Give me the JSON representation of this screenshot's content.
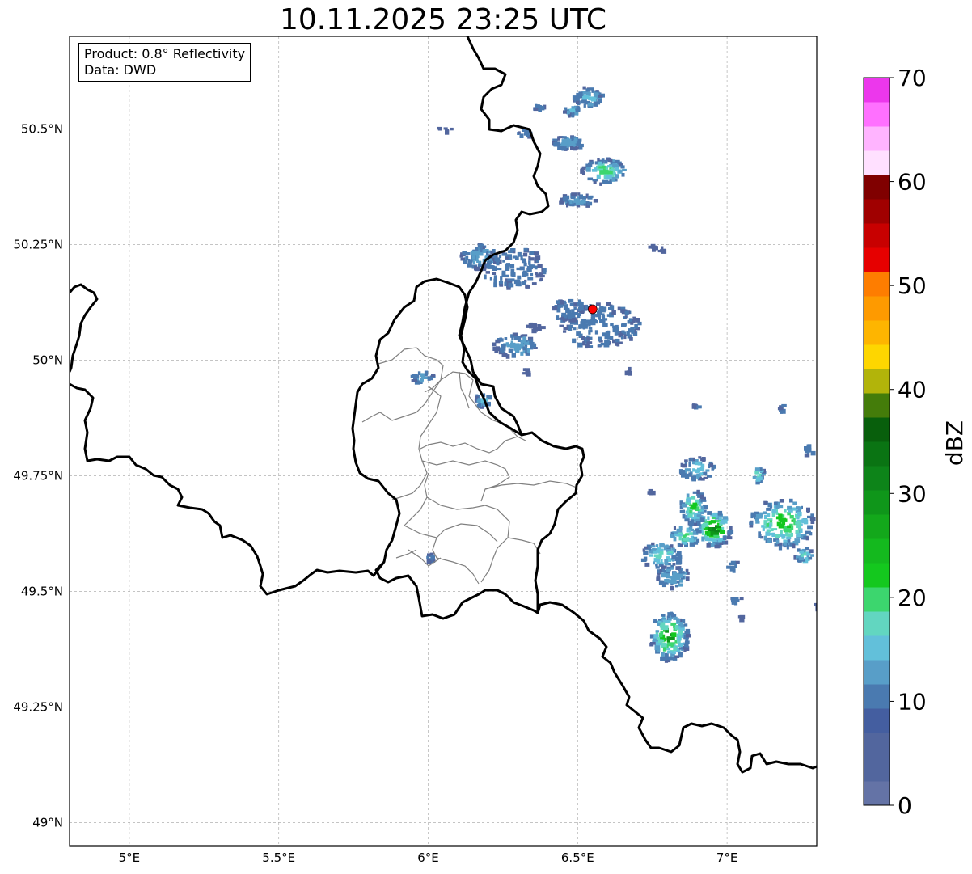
{
  "map": {
    "title": "10.11.2025 23:25 UTC",
    "info": {
      "product": "Product: 0.8° Reflectivity",
      "data": "Data: DWD"
    },
    "lon_ticks": [
      {
        "value": 5.0,
        "label": "5°E"
      },
      {
        "value": 5.5,
        "label": "5.5°E"
      },
      {
        "value": 6.0,
        "label": "6°E"
      },
      {
        "value": 6.5,
        "label": "6.5°E"
      },
      {
        "value": 7.0,
        "label": "7°E"
      }
    ],
    "lat_ticks": [
      {
        "value": 50.5,
        "label": "50.5°N"
      },
      {
        "value": 50.25,
        "label": "50.25°N"
      },
      {
        "value": 50.0,
        "label": "50°N"
      },
      {
        "value": 49.75,
        "label": "49.75°N"
      },
      {
        "value": 49.5,
        "label": "49.5°N"
      },
      {
        "value": 49.25,
        "label": "49.25°N"
      },
      {
        "value": 49.0,
        "label": "49°N"
      }
    ],
    "extent": {
      "lon_min": 4.8,
      "lon_max": 7.3,
      "lat_min": 48.95,
      "lat_max": 50.7
    },
    "radar_site": {
      "lon": 6.55,
      "lat": 50.11,
      "color": "#ff0000"
    },
    "grid": true
  },
  "colorbar": {
    "label": "dBZ",
    "min": 0,
    "max": 70,
    "ticks": [
      "0",
      "10",
      "20",
      "30",
      "40",
      "50",
      "60",
      "70"
    ],
    "colors": [
      "#6473a6",
      "#52669e",
      "#52669e",
      "#445ea0",
      "#4a7ab0",
      "#589ec8",
      "#62c0da",
      "#62d6c0",
      "#3cd66e",
      "#14c81e",
      "#14b91e",
      "#13a81b",
      "#0f961a",
      "#0d8419",
      "#0a7413",
      "#085f0c",
      "#447c0a",
      "#b2b40a",
      "#fed600",
      "#feb500",
      "#fe9a00",
      "#fe7d00",
      "#e60000",
      "#c80000",
      "#a00000",
      "#800000",
      "#ffe0ff",
      "#ffb4ff",
      "#ff70ff",
      "#ec37ec"
    ]
  }
}
